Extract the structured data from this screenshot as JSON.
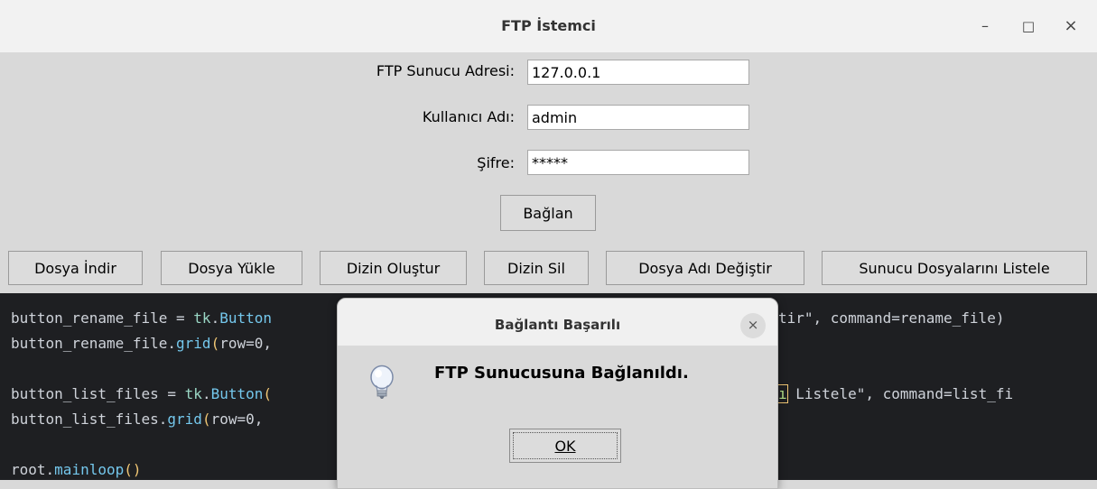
{
  "window": {
    "title": "FTP İstemci",
    "controls": {
      "minimize": "–",
      "maximize": "□",
      "close": "×"
    }
  },
  "form": {
    "server_label": "FTP Sunucu Adresi:",
    "server_value": "127.0.0.1",
    "user_label": "Kullanıcı Adı:",
    "user_value": "admin",
    "password_label": "Şifre:",
    "password_value": "*****",
    "connect_label": "Bağlan"
  },
  "toolbar": {
    "download": "Dosya İndir",
    "upload": "Dosya Yükle",
    "mkdir": "Dizin Oluştur",
    "rmdir": "Dizin Sil",
    "rename": "Dosya Adı Değiştir",
    "list": "Sunucu Dosyalarını Listele"
  },
  "editor": {
    "line1": {
      "name": "button_rename_file",
      "eq": " = ",
      "mod": "tk",
      "dot": ".",
      "cls": "Button"
    },
    "line2": {
      "name": "button_rename_file",
      "dot": ".",
      "fn": "grid",
      "paren": "(",
      "arg": "row=0,"
    },
    "line3": {
      "name": "button_list_files",
      "eq": " = ",
      "mod": "tk",
      "dot": ".",
      "cls": "Button",
      "paren": "("
    },
    "line4": {
      "name": "button_list_files",
      "dot": ".",
      "fn": "grid",
      "paren": "(",
      "arg": "row=0,"
    },
    "line5": {
      "name": "root",
      "dot": ".",
      "fn": "mainloop",
      "paren": "()"
    },
    "right1": "tir\", command=rename_file)",
    "right2_cursor": "ı",
    "right2_rest": " Listele\", command=list_fi"
  },
  "dialog": {
    "title": "Bağlantı Başarılı",
    "close": "×",
    "message": "FTP Sunucusuna Bağlanıldı.",
    "ok_label": "OK",
    "icon": "info-lightbulb-icon"
  },
  "colors": {
    "window_bg": "#d9d9d9",
    "titlebar_bg": "#f2f2f2",
    "editor_bg": "#1e1f22"
  }
}
